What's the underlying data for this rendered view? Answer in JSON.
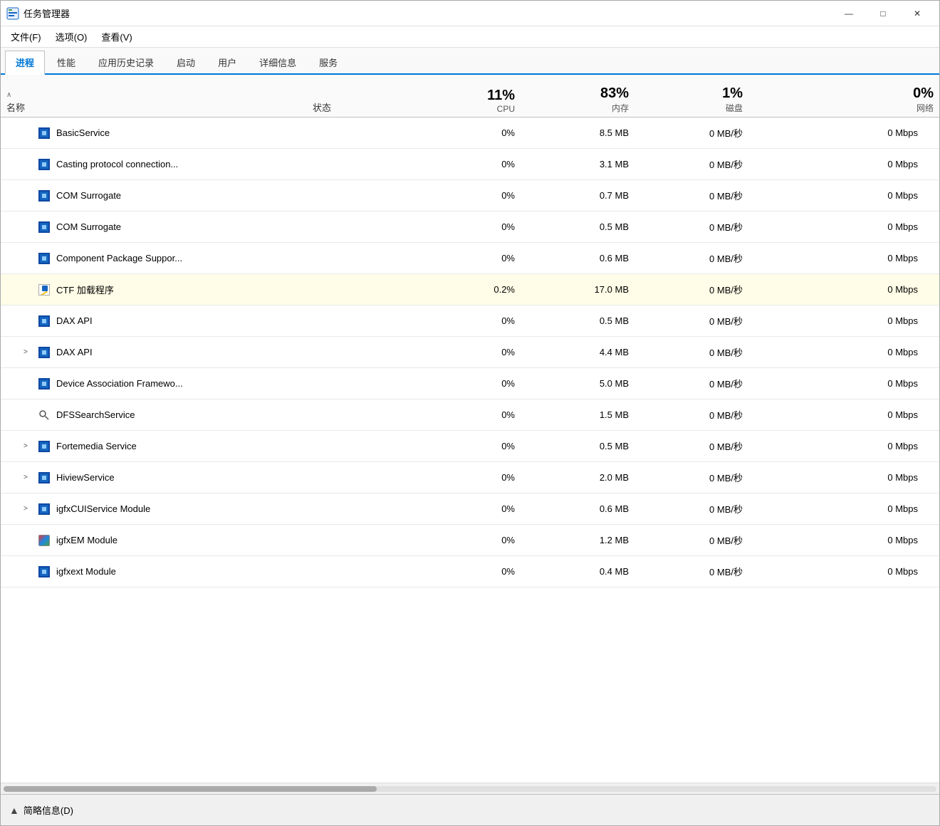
{
  "window": {
    "title": "任务管理器",
    "controls": {
      "minimize": "—",
      "maximize": "□",
      "close": "✕"
    }
  },
  "menu": {
    "items": [
      "文件(F)",
      "选项(O)",
      "查看(V)"
    ]
  },
  "tabs": [
    {
      "label": "进程",
      "active": true
    },
    {
      "label": "性能",
      "active": false
    },
    {
      "label": "应用历史记录",
      "active": false
    },
    {
      "label": "启动",
      "active": false
    },
    {
      "label": "用户",
      "active": false
    },
    {
      "label": "详细信息",
      "active": false
    },
    {
      "label": "服务",
      "active": false
    }
  ],
  "columns": {
    "name": "名称",
    "status": "状态",
    "cpu": {
      "percent": "11%",
      "label": "CPU"
    },
    "memory": {
      "percent": "83%",
      "label": "内存"
    },
    "disk": {
      "percent": "1%",
      "label": "磁盘"
    },
    "network": {
      "percent": "0%",
      "label": "网络"
    }
  },
  "processes": [
    {
      "name": "BasicService",
      "icon": "square",
      "indent": 1,
      "expand": false,
      "status": "",
      "cpu": "0%",
      "memory": "8.5 MB",
      "disk": "0 MB/秒",
      "network": "0 Mbps",
      "highlight": false
    },
    {
      "name": "Casting protocol connection...",
      "icon": "square",
      "indent": 1,
      "expand": false,
      "status": "",
      "cpu": "0%",
      "memory": "3.1 MB",
      "disk": "0 MB/秒",
      "network": "0 Mbps",
      "highlight": false
    },
    {
      "name": "COM Surrogate",
      "icon": "square",
      "indent": 1,
      "expand": false,
      "status": "",
      "cpu": "0%",
      "memory": "0.7 MB",
      "disk": "0 MB/秒",
      "network": "0 Mbps",
      "highlight": false
    },
    {
      "name": "COM Surrogate",
      "icon": "square",
      "indent": 1,
      "expand": false,
      "status": "",
      "cpu": "0%",
      "memory": "0.5 MB",
      "disk": "0 MB/秒",
      "network": "0 Mbps",
      "highlight": false
    },
    {
      "name": "Component Package Suppor...",
      "icon": "square",
      "indent": 1,
      "expand": false,
      "status": "",
      "cpu": "0%",
      "memory": "0.6 MB",
      "disk": "0 MB/秒",
      "network": "0 Mbps",
      "highlight": false
    },
    {
      "name": "CTF 加载程序",
      "icon": "pen",
      "indent": 1,
      "expand": false,
      "status": "",
      "cpu": "0.2%",
      "memory": "17.0 MB",
      "disk": "0 MB/秒",
      "network": "0 Mbps",
      "highlight": true
    },
    {
      "name": "DAX API",
      "icon": "square",
      "indent": 1,
      "expand": false,
      "status": "",
      "cpu": "0%",
      "memory": "0.5 MB",
      "disk": "0 MB/秒",
      "network": "0 Mbps",
      "highlight": false
    },
    {
      "name": "DAX API",
      "icon": "square",
      "indent": 1,
      "expand": true,
      "status": "",
      "cpu": "0%",
      "memory": "4.4 MB",
      "disk": "0 MB/秒",
      "network": "0 Mbps",
      "highlight": false
    },
    {
      "name": "Device Association Framewo...",
      "icon": "square",
      "indent": 1,
      "expand": false,
      "status": "",
      "cpu": "0%",
      "memory": "5.0 MB",
      "disk": "0 MB/秒",
      "network": "0 Mbps",
      "highlight": false
    },
    {
      "name": "DFSSearchService",
      "icon": "search",
      "indent": 1,
      "expand": false,
      "status": "",
      "cpu": "0%",
      "memory": "1.5 MB",
      "disk": "0 MB/秒",
      "network": "0 Mbps",
      "highlight": false
    },
    {
      "name": "Fortemedia Service",
      "icon": "square",
      "indent": 1,
      "expand": true,
      "status": "",
      "cpu": "0%",
      "memory": "0.5 MB",
      "disk": "0 MB/秒",
      "network": "0 Mbps",
      "highlight": false
    },
    {
      "name": "HiviewService",
      "icon": "square",
      "indent": 1,
      "expand": true,
      "status": "",
      "cpu": "0%",
      "memory": "2.0 MB",
      "disk": "0 MB/秒",
      "network": "0 Mbps",
      "highlight": false
    },
    {
      "name": "igfxCUIService Module",
      "icon": "square",
      "indent": 1,
      "expand": true,
      "status": "",
      "cpu": "0%",
      "memory": "0.6 MB",
      "disk": "0 MB/秒",
      "network": "0 Mbps",
      "highlight": false
    },
    {
      "name": "igfxEM Module",
      "icon": "colorbox",
      "indent": 1,
      "expand": false,
      "status": "",
      "cpu": "0%",
      "memory": "1.2 MB",
      "disk": "0 MB/秒",
      "network": "0 Mbps",
      "highlight": false
    },
    {
      "name": "igfxext Module",
      "icon": "square",
      "indent": 1,
      "expand": false,
      "status": "",
      "cpu": "0%",
      "memory": "0.4 MB",
      "disk": "0 MB/秒",
      "network": "0 Mbps",
      "highlight": false
    }
  ],
  "statusbar": {
    "icon": "▲",
    "text": "简略信息(D)"
  }
}
